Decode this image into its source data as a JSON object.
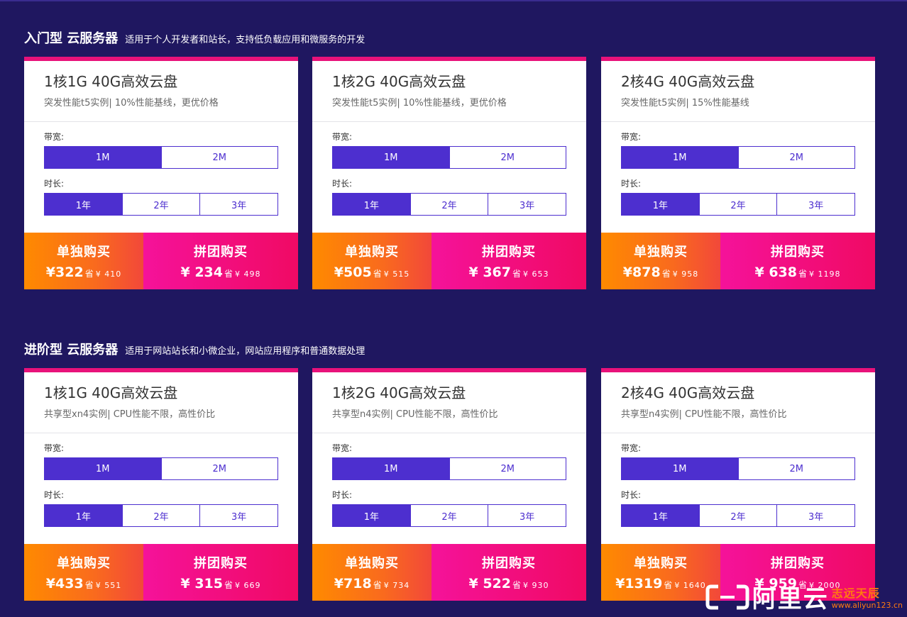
{
  "sections": [
    {
      "title": "入门型 云服务器",
      "subtitle": "适用于个人开发者和站长，支持低负载应用和微服务的开发",
      "cards": [
        {
          "title": "1核1G 40G高效云盘",
          "desc": "突发性能t5实例| 10%性能基线，更优价格",
          "solo_price": "¥322",
          "solo_orig": "¥ 410",
          "group_price": "¥ 234",
          "group_orig": "¥ 498"
        },
        {
          "title": "1核2G 40G高效云盘",
          "desc": "突发性能t5实例| 10%性能基线，更优价格",
          "solo_price": "¥505",
          "solo_orig": "¥ 515",
          "group_price": "¥ 367",
          "group_orig": "¥ 653"
        },
        {
          "title": "2核4G 40G高效云盘",
          "desc": "突发性能t5实例| 15%性能基线",
          "solo_price": "¥878",
          "solo_orig": "¥ 958",
          "group_price": "¥ 638",
          "group_orig": "¥ 1198"
        }
      ]
    },
    {
      "title": "进阶型 云服务器",
      "subtitle": "适用于网站站长和小微企业，网站应用程序和普通数据处理",
      "cards": [
        {
          "title": "1核1G 40G高效云盘",
          "desc": "共享型xn4实例| CPU性能不限，高性价比",
          "solo_price": "¥433",
          "solo_orig": "¥ 551",
          "group_price": "¥ 315",
          "group_orig": "¥ 669"
        },
        {
          "title": "1核2G 40G高效云盘",
          "desc": "共享型n4实例| CPU性能不限，高性价比",
          "solo_price": "¥718",
          "solo_orig": "¥ 734",
          "group_price": "¥ 522",
          "group_orig": "¥ 930"
        },
        {
          "title": "2核4G 40G高效云盘",
          "desc": "共享型n4实例| CPU性能不限，高性价比",
          "solo_price": "¥1319",
          "solo_orig": "¥ 1640",
          "group_price": "¥ 959",
          "group_orig": "¥ 2000"
        }
      ]
    }
  ],
  "labels": {
    "bandwidth": "带宽:",
    "duration": "时长:",
    "bandwidth_options": [
      "1M",
      "2M"
    ],
    "duration_options": [
      "1年",
      "2年",
      "3年"
    ],
    "solo_buy": "单独购买",
    "group_buy": "拼团购买",
    "orig_prefix": "省"
  },
  "selected": {
    "bandwidth": 0,
    "duration": 0
  },
  "watermark": {
    "brand": "阿里云",
    "cn": "志远天辰",
    "url": "www.aliyun123.cn"
  },
  "colors": {
    "background": "#1f1760",
    "accent": "#4d2fcf",
    "solo": "#ff8a00",
    "group": "#f00a64"
  }
}
